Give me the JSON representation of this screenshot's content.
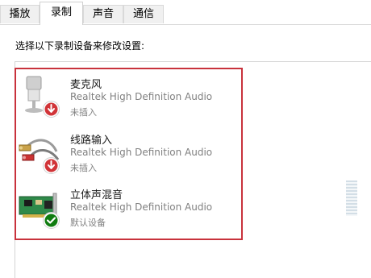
{
  "tabs": [
    {
      "label": "播放"
    },
    {
      "label": "录制"
    },
    {
      "label": "声音"
    },
    {
      "label": "通信"
    }
  ],
  "instruction": "选择以下录制设备来修改设置:",
  "devices": [
    {
      "name": "麦克风",
      "driver": "Realtek High Definition Audio",
      "status": "未插入",
      "icon": "microphone-icon",
      "badge": "unplugged-down-arrow-icon"
    },
    {
      "name": "线路输入",
      "driver": "Realtek High Definition Audio",
      "status": "未插入",
      "icon": "line-in-cable-icon",
      "badge": "unplugged-down-arrow-icon"
    },
    {
      "name": "立体声混音",
      "driver": "Realtek High Definition Audio",
      "status": "默认设备",
      "icon": "sound-card-icon",
      "badge": "default-checkmark-icon"
    }
  ],
  "colors": {
    "highlight_border": "#c8323c",
    "unplugged_badge": "#d13438",
    "default_badge": "#107c10"
  }
}
